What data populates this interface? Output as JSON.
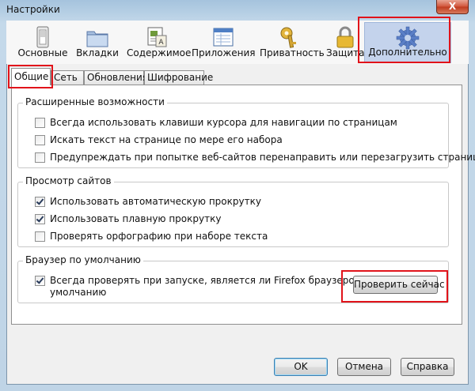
{
  "window": {
    "title": "Настройки",
    "close_glyph": "X"
  },
  "toolbar": {
    "panes": [
      {
        "label": "Основные",
        "icon": "light-switch-icon"
      },
      {
        "label": "Вкладки",
        "icon": "folder-tabs-icon"
      },
      {
        "label": "Содержимое",
        "icon": "content-page-icon"
      },
      {
        "label": "Приложения",
        "icon": "applications-window-icon"
      },
      {
        "label": "Приватность",
        "icon": "key-icon"
      },
      {
        "label": "Защита",
        "icon": "padlock-icon"
      },
      {
        "label": "Дополнительно",
        "icon": "gear-icon",
        "selected": true
      }
    ]
  },
  "tabs": [
    {
      "label": "Общие",
      "active": true
    },
    {
      "label": "Сеть"
    },
    {
      "label": "Обновления"
    },
    {
      "label": "Шифрование"
    }
  ],
  "sections": {
    "accessibility": {
      "title": "Расширенные возможности",
      "items": [
        {
          "label": "Всегда использовать клавиши курсора для навигации по страницам",
          "checked": false
        },
        {
          "label": "Искать текст на странице по мере его набора",
          "checked": false
        },
        {
          "label": "Предупреждать при попытке веб-сайтов перенаправить или перезагрузить страницу",
          "checked": false
        }
      ]
    },
    "browsing": {
      "title": "Просмотр сайтов",
      "items": [
        {
          "label": "Использовать автоматическую прокрутку",
          "checked": true
        },
        {
          "label": "Использовать плавную прокрутку",
          "checked": true
        },
        {
          "label": "Проверять орфографию при наборе текста",
          "checked": false
        }
      ]
    },
    "default_browser": {
      "title": "Браузер по умолчанию",
      "check": {
        "line1": "Всегда проверять при запуске, является ли Firefox браузером по",
        "line2": "умолчанию",
        "checked": true
      },
      "button": "Проверить сейчас"
    }
  },
  "buttons": {
    "ok": "OK",
    "cancel": "Отмена",
    "help": "Справка"
  },
  "colors": {
    "highlight": "#e1131a",
    "selected_pane": "#c4d3ec",
    "gear": "#5b7fc7"
  }
}
